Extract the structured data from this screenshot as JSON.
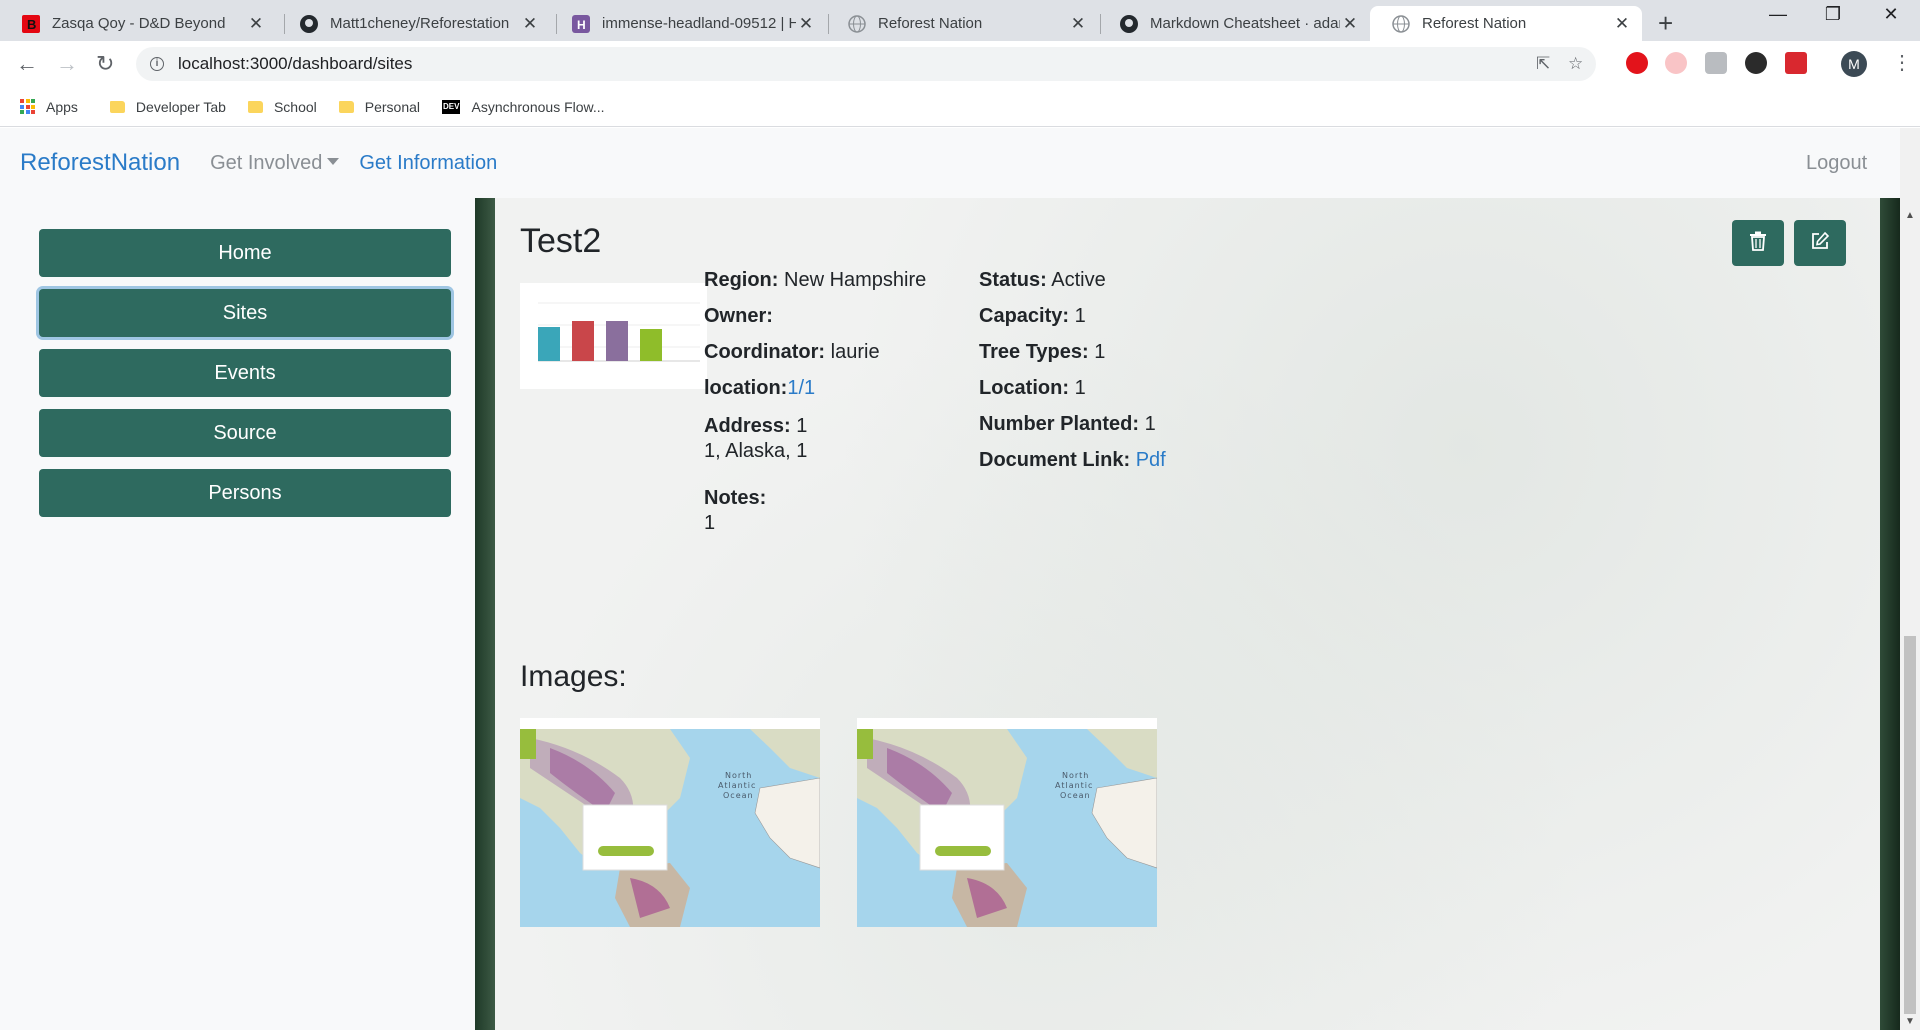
{
  "browser": {
    "tabs": [
      {
        "title": "Zasqa Qoy - D&D Beyond",
        "favicon": "dnd-beyond-icon",
        "active": false
      },
      {
        "title": "Matt1cheney/Reforestation",
        "favicon": "github-icon",
        "active": false
      },
      {
        "title": "immense-headland-09512 | H",
        "favicon": "heroku-icon",
        "active": false
      },
      {
        "title": "Reforest Nation",
        "favicon": "globe-icon",
        "active": false
      },
      {
        "title": "Markdown Cheatsheet · adam",
        "favicon": "github-icon",
        "active": false
      },
      {
        "title": "Reforest Nation",
        "favicon": "globe-icon",
        "active": true
      }
    ],
    "url": "localhost:3000/dashboard/sites",
    "profile_initial": "M",
    "bookmarks": [
      {
        "label": "Apps",
        "icon": "apps-grid-icon"
      },
      {
        "label": "Developer Tab",
        "icon": "folder-icon"
      },
      {
        "label": "School",
        "icon": "folder-icon"
      },
      {
        "label": "Personal",
        "icon": "folder-icon"
      },
      {
        "label": "Asynchronous Flow...",
        "icon": "dev-icon",
        "icon_text": "DEV"
      }
    ]
  },
  "navbar": {
    "brand": "ReforestNation",
    "get_involved": "Get Involved",
    "get_information": "Get Information",
    "logout": "Logout"
  },
  "sidebar": {
    "items": [
      {
        "label": "Home",
        "active": false
      },
      {
        "label": "Sites",
        "active": true
      },
      {
        "label": "Events",
        "active": false
      },
      {
        "label": "Source",
        "active": false
      },
      {
        "label": "Persons",
        "active": false
      }
    ]
  },
  "site": {
    "title": "Test2",
    "left_fields": {
      "region_label": "Region:",
      "region_value": "New Hampshire",
      "owner_label": "Owner:",
      "owner_value": "",
      "coordinator_label": "Coordinator:",
      "coordinator_value": "laurie",
      "location_label": "location:",
      "location_link": "1/1",
      "address_label": "Address:",
      "address_line1": "1",
      "address_line2": "1, Alaska, 1",
      "notes_label": "Notes:",
      "notes_value": "1"
    },
    "right_fields": {
      "status_label": "Status:",
      "status_value": "Active",
      "capacity_label": "Capacity:",
      "capacity_value": "1",
      "tree_types_label": "Tree Types:",
      "tree_types_value": "1",
      "location_label": "Location:",
      "location_value": "1",
      "number_planted_label": "Number Planted:",
      "number_planted_value": "1",
      "document_link_label": "Document Link:",
      "document_link_value": "Pdf"
    },
    "images_heading": "Images:",
    "thumbnail_bar_colors": [
      "#3aa6b9",
      "#c9464a",
      "#8a6f9d",
      "#8fbd2a"
    ]
  },
  "colors": {
    "primary_green": "#2e6a5f",
    "link_blue": "#2a7bc8"
  }
}
